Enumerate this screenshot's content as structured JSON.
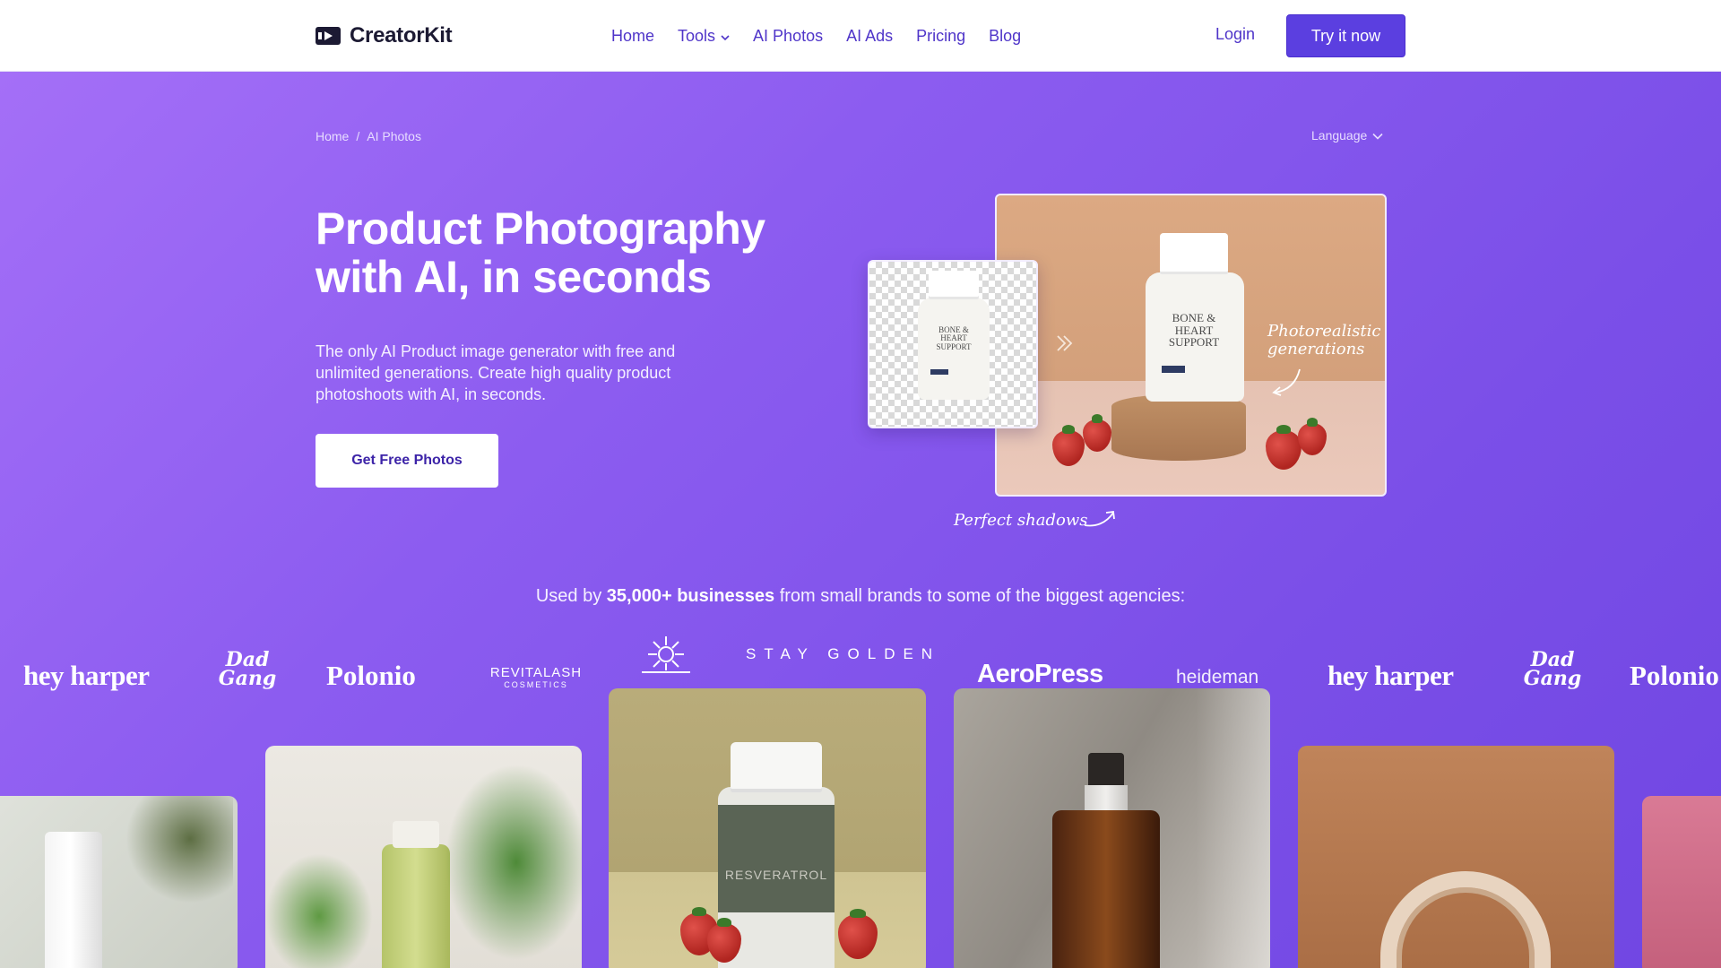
{
  "header": {
    "brand": "CreatorKit",
    "nav": [
      "Home",
      "Tools",
      "AI Photos",
      "AI Ads",
      "Pricing",
      "Blog"
    ],
    "login": "Login",
    "cta": "Try it now"
  },
  "breadcrumb": {
    "home": "Home",
    "separator": "/",
    "current": "AI Photos"
  },
  "language": "Language",
  "hero": {
    "title_line1": "Product Photography",
    "title_line2": "with AI, in seconds",
    "description": "The only AI Product image generator with free and unlimited generations. Create high quality product photoshoots with AI, in seconds.",
    "cta": "Get Free Photos"
  },
  "showcase": {
    "photorealistic_line1": "Photorealistic",
    "photorealistic_line2": "generations",
    "shadows": "Perfect shadows",
    "bottle_label_1": "BONE &",
    "bottle_label_2": "HEART",
    "bottle_label_3": "SUPPORT"
  },
  "used_by": {
    "prefix": "Used by ",
    "highlight": "35,000+ businesses",
    "suffix": " from small brands to some of the biggest agencies:"
  },
  "brands": [
    "hey harper",
    "Dad Gang",
    "Polonio",
    "REVITALASH",
    "COSMETICS",
    "STAY GOLDEN",
    "AeroPress",
    "heideman",
    "hey harper",
    "Dad Gang",
    "Polonio"
  ],
  "gallery": {
    "resveratrol": "RESVERATROL"
  },
  "colors": {
    "accent": "#5b3fe0",
    "hero_bg": "#8c5cf0",
    "nav_link": "#4f35c9"
  },
  "icons": [
    "logo-play-icon",
    "chevron-down-icon",
    "double-chevron-icon",
    "curved-arrow-icon"
  ]
}
